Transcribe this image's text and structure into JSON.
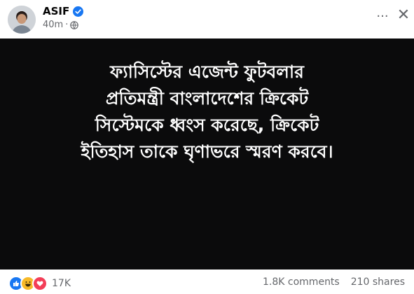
{
  "post": {
    "author": "ASIF",
    "time": "40m",
    "dot": "·",
    "privacy_icon": "globe-icon",
    "verified_icon": "verified-badge-icon"
  },
  "header_actions": {
    "more": "···",
    "close": "✕"
  },
  "image_text": {
    "line1": "ফ্যাসিস্টের এজেন্ট ফুটবলার",
    "line2": "প্রতিমন্ত্রী বাংলাদেশের ক্রিকেট",
    "line3": "সিস্টেমকে ধ্বংস করেছে, ক্রিকেট",
    "line4": "ইতিহাস তাকে ঘৃণাভরে স্মরণ করবে।"
  },
  "footer": {
    "reactions": [
      "like-icon",
      "haha-icon",
      "love-icon"
    ],
    "reaction_count": "17K",
    "comments": "1.8K comments",
    "shares": "210 shares"
  },
  "colors": {
    "image_bg": "#0b0b0c",
    "verified": "#1877f2",
    "secondary_text": "#65676b"
  }
}
